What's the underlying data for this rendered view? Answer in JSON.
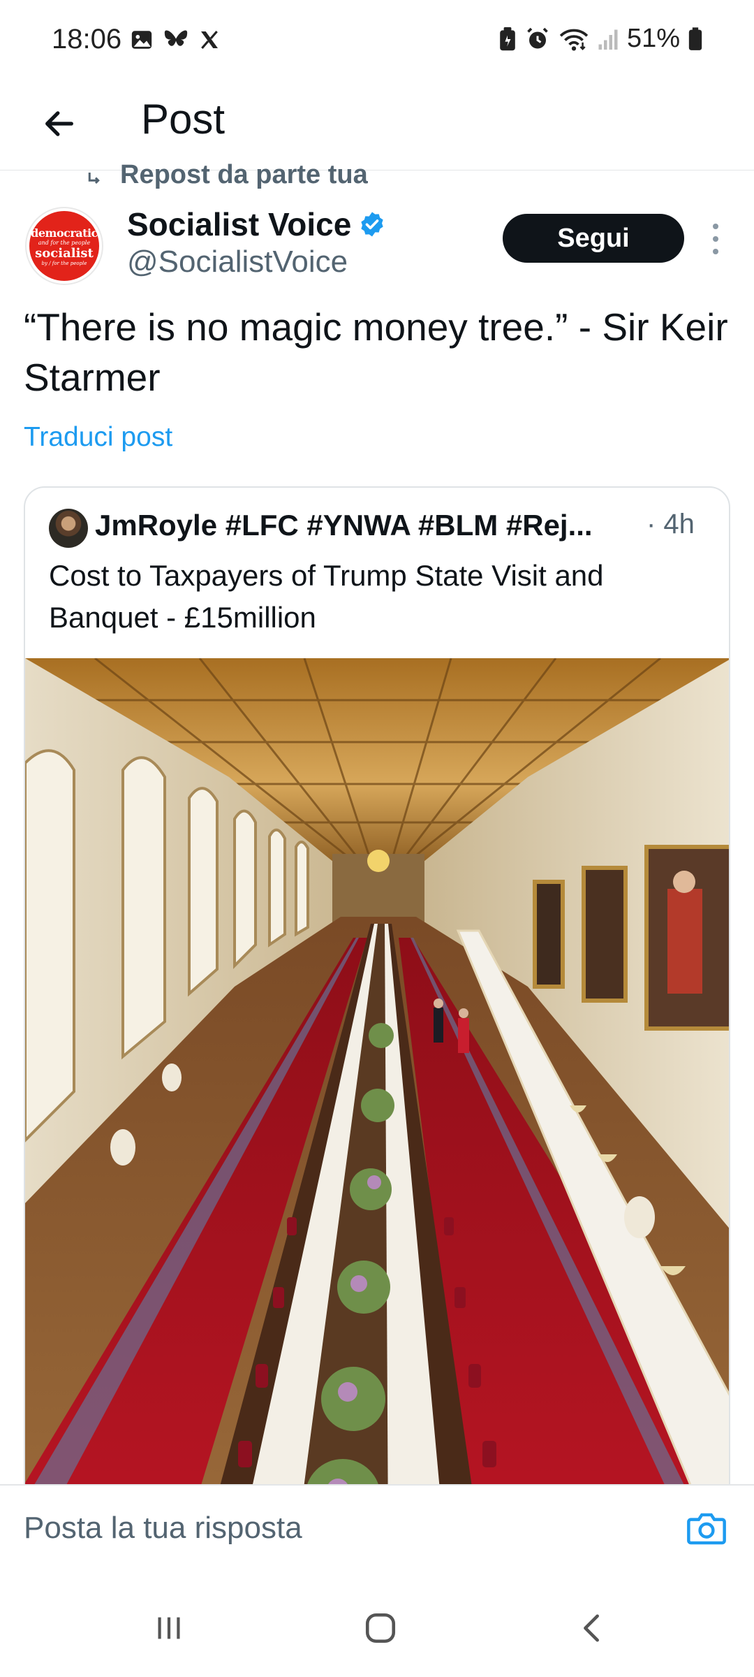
{
  "status_bar": {
    "time": "18:06",
    "battery_percent": "51%",
    "left_icons": [
      "gallery-icon",
      "bluesky-icon",
      "x-icon"
    ],
    "right_icons": [
      "battery-saver-icon",
      "alarm-icon",
      "wifi-icon",
      "signal-icon",
      "battery-icon"
    ]
  },
  "header": {
    "title": "Post"
  },
  "repost": {
    "label": "Repost da parte tua"
  },
  "author": {
    "name": "Socialist Voice",
    "handle": "@SocialistVoice",
    "verified": true,
    "avatar_text": [
      "democratic",
      "and for the people",
      "socialist",
      "by / for the people"
    ]
  },
  "follow_button": "Segui",
  "post": {
    "text": "“There is no magic money tree.” - Sir Keir Starmer",
    "translate_label": "Traduci post"
  },
  "quoted_post": {
    "author": "JmRoyle #LFC #YNWA #BLM #Rej...",
    "time": "· 4h",
    "text": "Cost to Taxpayers of Trump State Visit and Banquet - £15million"
  },
  "reply": {
    "placeholder": "Posta la tua risposta"
  },
  "colors": {
    "accent": "#1d9bf0",
    "follow_bg": "#0f1419",
    "carpet": "#a5101c",
    "wood": "#c89b4a"
  }
}
